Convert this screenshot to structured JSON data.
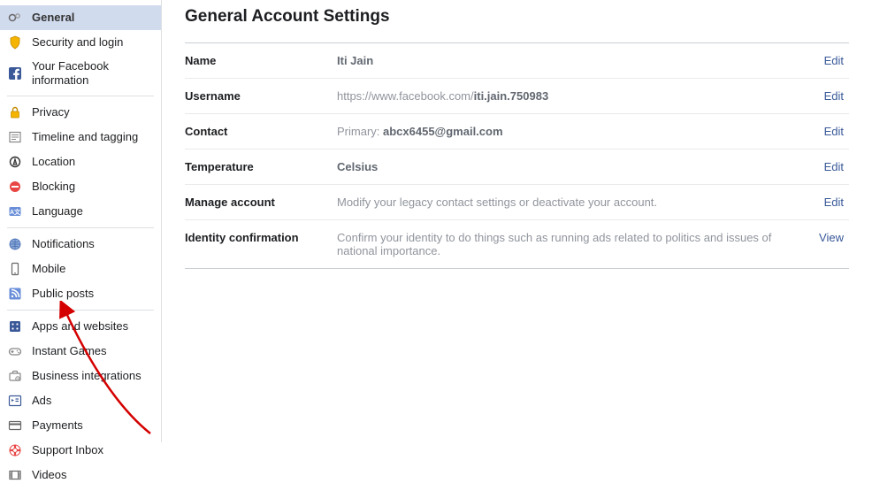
{
  "page": {
    "title": "General Account Settings"
  },
  "sidebar": {
    "groups": [
      {
        "items": [
          {
            "id": "general",
            "label": "General",
            "icon": "gear-icon",
            "active": true
          },
          {
            "id": "security",
            "label": "Security and login",
            "icon": "shield-icon"
          },
          {
            "id": "yourinfo",
            "label": "Your Facebook information",
            "icon": "facebook-icon"
          }
        ]
      },
      {
        "items": [
          {
            "id": "privacy",
            "label": "Privacy",
            "icon": "lock-icon"
          },
          {
            "id": "timeline",
            "label": "Timeline and tagging",
            "icon": "news-icon"
          },
          {
            "id": "location",
            "label": "Location",
            "icon": "location-icon"
          },
          {
            "id": "blocking",
            "label": "Blocking",
            "icon": "blocking-icon"
          },
          {
            "id": "language",
            "label": "Language",
            "icon": "language-icon"
          }
        ]
      },
      {
        "items": [
          {
            "id": "notifications",
            "label": "Notifications",
            "icon": "globe-icon"
          },
          {
            "id": "mobile",
            "label": "Mobile",
            "icon": "mobile-icon"
          },
          {
            "id": "publicposts",
            "label": "Public posts",
            "icon": "rss-icon"
          }
        ]
      },
      {
        "items": [
          {
            "id": "apps",
            "label": "Apps and websites",
            "icon": "apps-icon"
          },
          {
            "id": "games",
            "label": "Instant Games",
            "icon": "gamepad-icon"
          },
          {
            "id": "bizint",
            "label": "Business integrations",
            "icon": "briefcase-icon"
          },
          {
            "id": "ads",
            "label": "Ads",
            "icon": "ad-icon"
          },
          {
            "id": "payments",
            "label": "Payments",
            "icon": "card-icon"
          },
          {
            "id": "support",
            "label": "Support Inbox",
            "icon": "lifesaver-icon"
          },
          {
            "id": "videos",
            "label": "Videos",
            "icon": "video-icon"
          }
        ]
      }
    ]
  },
  "settings": {
    "rows": [
      {
        "label": "Name",
        "value_html": "<span class='strong'>Iti Jain</span>",
        "action": "Edit"
      },
      {
        "label": "Username",
        "value_html": "https://www.facebook.com/<span class='strong'>iti.jain.750983</span>",
        "action": "Edit"
      },
      {
        "label": "Contact",
        "value_html": "Primary: <span class='strong'>abcx6455@gmail.com</span>",
        "action": "Edit"
      },
      {
        "label": "Temperature",
        "value_html": "<span class='strong'>Celsius</span>",
        "action": "Edit"
      },
      {
        "label": "Manage account",
        "value_html": "Modify your legacy contact settings or deactivate your account.",
        "action": "Edit"
      },
      {
        "label": "Identity confirmation",
        "value_html": "Confirm your identity to do things such as running ads related to politics and issues of national importance.",
        "action": "View"
      }
    ]
  },
  "icons": {
    "gear-icon": "<svg viewBox='0 0 16 16' width='16' height='16'><circle cx='5' cy='8' r='3.5' fill='none' stroke='#666' stroke-width='1.5'/><circle cx='11' cy='6' r='2.2' fill='none' stroke='#999' stroke-width='1.3'/></svg>",
    "shield-icon": "<svg viewBox='0 0 16 16' width='16' height='16'><path d='M8 1 L13 3 V7 C13 11 10.5 13.5 8 15 C5.5 13.5 3 11 3 7 V3 Z' fill='#f5b400' stroke='#c08a00' stroke-width='0.8'/></svg>",
    "facebook-icon": "<svg viewBox='0 0 16 16' width='16' height='16'><rect x='1' y='1' width='14' height='14' rx='2' fill='#3b5998'/><path d='M10.5 16 V10 h2 l.35-2.4 H10.5 V6.1 c0-.7.2-1.1 1.2-1.1h1.2V2.8C12.6 2.75 11.9 2.7 11.1 2.7 9.3 2.7 8.1 3.8 8.1 5.8 V7.6 H6.1 V10 H8.1 V16 Z' fill='#fff'/></svg>",
    "lock-icon": "<svg viewBox='0 0 16 16' width='16' height='16'><rect x='3.5' y='7' width='9' height='7' rx='1' fill='#f5b400' stroke='#c08a00' stroke-width='0.7'/><path d='M5.5 7 V5 a2.5 2.5 0 0 1 5 0 V7' fill='none' stroke='#c08a00' stroke-width='1.4'/></svg>",
    "news-icon": "<svg viewBox='0 0 16 16' width='16' height='16'><rect x='2' y='2.5' width='12' height='11' fill='none' stroke='#888' stroke-width='1.2'/><line x1='4' y1='5.5' x2='12' y2='5.5' stroke='#888'/><line x1='4' y1='8' x2='12' y2='8' stroke='#888'/><line x1='4' y1='10.5' x2='9' y2='10.5' stroke='#888'/></svg>",
    "location-icon": "<svg viewBox='0 0 16 16' width='16' height='16'><circle cx='8' cy='8' r='5.5' fill='none' stroke='#333' stroke-width='1.4'/><path d='M6.2 11 L8 5 L9.8 11 Z' fill='none' stroke='#333' stroke-width='1.2'/><line x1='6.8' y1='9' x2='9.2' y2='9' stroke='#333'/></svg>",
    "blocking-icon": "<svg viewBox='0 0 16 16' width='16' height='16'><circle cx='8' cy='8' r='6' fill='#e84545'/><rect x='4' y='7' width='8' height='2' fill='#fff'/></svg>",
    "language-icon": "<svg viewBox='0 0 16 16' width='16' height='16'><rect x='1.5' y='3' width='13' height='10' rx='1.5' fill='#6a8fd8'/><text x='8' y='11' text-anchor='middle' font-size='7' fill='#fff' font-family='Arial' font-weight='bold'>A文</text></svg>",
    "globe-icon": "<svg viewBox='0 0 16 16' width='16' height='16'><circle cx='8' cy='8' r='6' fill='#8aa9d6' stroke='#4267b2' stroke-width='0.8'/><path d='M2 8 h12 M8 2 v12 M3.5 4.5 a8 8 0 0 0 9 0 M3.5 11.5 a8 8 0 0 1 9 0' stroke='#4267b2' stroke-width='0.7' fill='none'/></svg>",
    "mobile-icon": "<svg viewBox='0 0 16 16' width='16' height='16'><rect x='4.5' y='1.5' width='7' height='13' rx='1' fill='none' stroke='#666' stroke-width='1.2'/><circle cx='8' cy='12.7' r='0.8' fill='#666'/></svg>",
    "rss-icon": "<svg viewBox='0 0 16 16' width='16' height='16'><rect x='1.5' y='1.5' width='13' height='13' rx='1.5' fill='#6a8fd8'/><circle cx='5' cy='11' r='1.2' fill='#fff'/><path d='M4 6.5 a5.5 5.5 0 0 1 5.5 5.5' stroke='#fff' stroke-width='1.6' fill='none'/><path d='M4 3.5 a8.5 8.5 0 0 1 8.5 8.5' stroke='#fff' stroke-width='1.6' fill='none'/></svg>",
    "apps-icon": "<svg viewBox='0 0 16 16' width='16' height='16'><rect x='2' y='2' width='12' height='12' rx='1.5' fill='#3b5998'/><circle cx='5.5' cy='5.5' r='1.1' fill='#fff'/><circle cx='10.5' cy='5.5' r='1.1' fill='#fff'/><circle cx='5.5' cy='10.5' r='1.1' fill='#fff'/><circle cx='10.5' cy='10.5' r='1.1' fill='#fff'/></svg>",
    "gamepad-icon": "<svg viewBox='0 0 16 16' width='16' height='16'><rect x='1.5' y='5' width='13' height='7' rx='3.5' fill='none' stroke='#888' stroke-width='1.3'/><line x1='5' y1='7' x2='5' y2='10' stroke='#888' stroke-width='1.3'/><line x1='3.5' y1='8.5' x2='6.5' y2='8.5' stroke='#888' stroke-width='1.3'/><circle cx='10.5' cy='7.5' r='0.8' fill='#888'/><circle cx='12' cy='9.5' r='0.8' fill='#888'/></svg>",
    "briefcase-icon": "<svg viewBox='0 0 16 16' width='16' height='16'><rect x='2' y='5' width='12' height='8' rx='1' fill='none' stroke='#888' stroke-width='1.2'/><path d='M5.5 5 V3.5 a1 1 0 0 1 1-1 h3 a1 1 0 0 1 1 1 V5' fill='none' stroke='#888' stroke-width='1.2'/><circle cx='11' cy='11' r='2.2' fill='none' stroke='#888' stroke-width='1'/><path d='M11 10 v1 l.8.5' stroke='#888' stroke-width='0.8' fill='none'/></svg>",
    "ad-icon": "<svg viewBox='0 0 16 16' width='16' height='16'><rect x='1.5' y='2.5' width='13' height='11' rx='1' fill='none' stroke='#3b5998' stroke-width='1.2'/><path d='M4 9 V6 l3 1.5 Z' fill='#3b5998'/><line x1='8.5' y1='6' x2='12' y2='6' stroke='#3b5998' stroke-width='1.2'/><line x1='8.5' y1='8.5' x2='12' y2='8.5' stroke='#3b5998' stroke-width='1.2'/></svg>",
    "card-icon": "<svg viewBox='0 0 16 16' width='16' height='16'><rect x='1.5' y='3.5' width='13' height='9' rx='1' fill='none' stroke='#666' stroke-width='1.2'/><rect x='1.5' y='5.5' width='13' height='2' fill='#666'/></svg>",
    "lifesaver-icon": "<svg viewBox='0 0 16 16' width='16' height='16'><circle cx='8' cy='8' r='6' fill='#fff' stroke='#e84545' stroke-width='1'/><circle cx='8' cy='8' r='2.4' fill='#fff' stroke='#e84545' stroke-width='1'/><path d='M8 2 V5.6 M8 10.4 V14 M2 8 H5.6 M10.4 8 H14' stroke='#e84545' stroke-width='2.2'/></svg>",
    "video-icon": "<svg viewBox='0 0 16 16' width='16' height='16'><rect x='2' y='3.5' width='12' height='9' fill='none' stroke='#666' stroke-width='1.2'/><line x1='4.5' y1='3.5' x2='4.5' y2='12.5' stroke='#666'/><line x1='11.5' y1='3.5' x2='11.5' y2='12.5' stroke='#666'/><line x1='2' y1='6' x2='4.5' y2='6' stroke='#666'/><line x1='2' y1='8' x2='4.5' y2='8' stroke='#666'/><line x1='2' y1='10' x2='4.5' y2='10' stroke='#666'/><line x1='11.5' y1='6' x2='14' y2='6' stroke='#666'/><line x1='11.5' y1='8' x2='14' y2='8' stroke='#666'/><line x1='11.5' y1='10' x2='14' y2='10' stroke='#666'/></svg>"
  }
}
